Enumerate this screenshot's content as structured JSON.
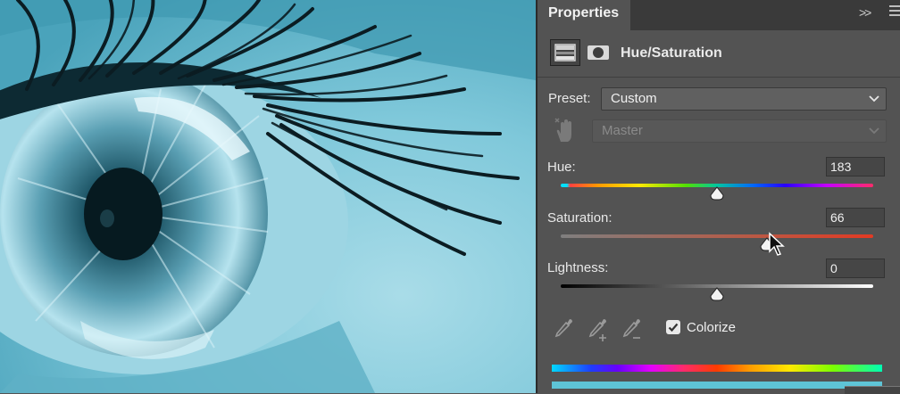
{
  "panel": {
    "tab_label": "Properties",
    "collapse_glyph": ">>",
    "adjustment_title": "Hue/Saturation",
    "preset": {
      "label": "Preset:",
      "value": "Custom"
    },
    "channel": {
      "value": "Master",
      "disabled": true
    },
    "hue": {
      "label": "Hue:",
      "value": "183",
      "fraction": 0.5
    },
    "saturation": {
      "label": "Saturation:",
      "value": "66",
      "fraction": 0.66
    },
    "lightness": {
      "label": "Lightness:",
      "value": "0",
      "fraction": 0.5
    },
    "colorize": {
      "label": "Colorize",
      "checked": true
    }
  },
  "colors": {
    "panel_bg": "#535353",
    "tabbar_bg": "#3a3a3a",
    "image_tint": "#5fb3c8",
    "colorize_result": "#5ec4d6"
  },
  "icons": {
    "adjustment": "hue-saturation-adjustment-icon",
    "mask": "layer-mask-icon",
    "hand": "on-image-adjustment-hand-icon",
    "eyedroppers": [
      "eyedropper-icon",
      "eyedropper-plus-icon",
      "eyedropper-minus-icon"
    ],
    "menu": "panel-menu-icon",
    "cursor": "mouse-pointer-icon"
  }
}
